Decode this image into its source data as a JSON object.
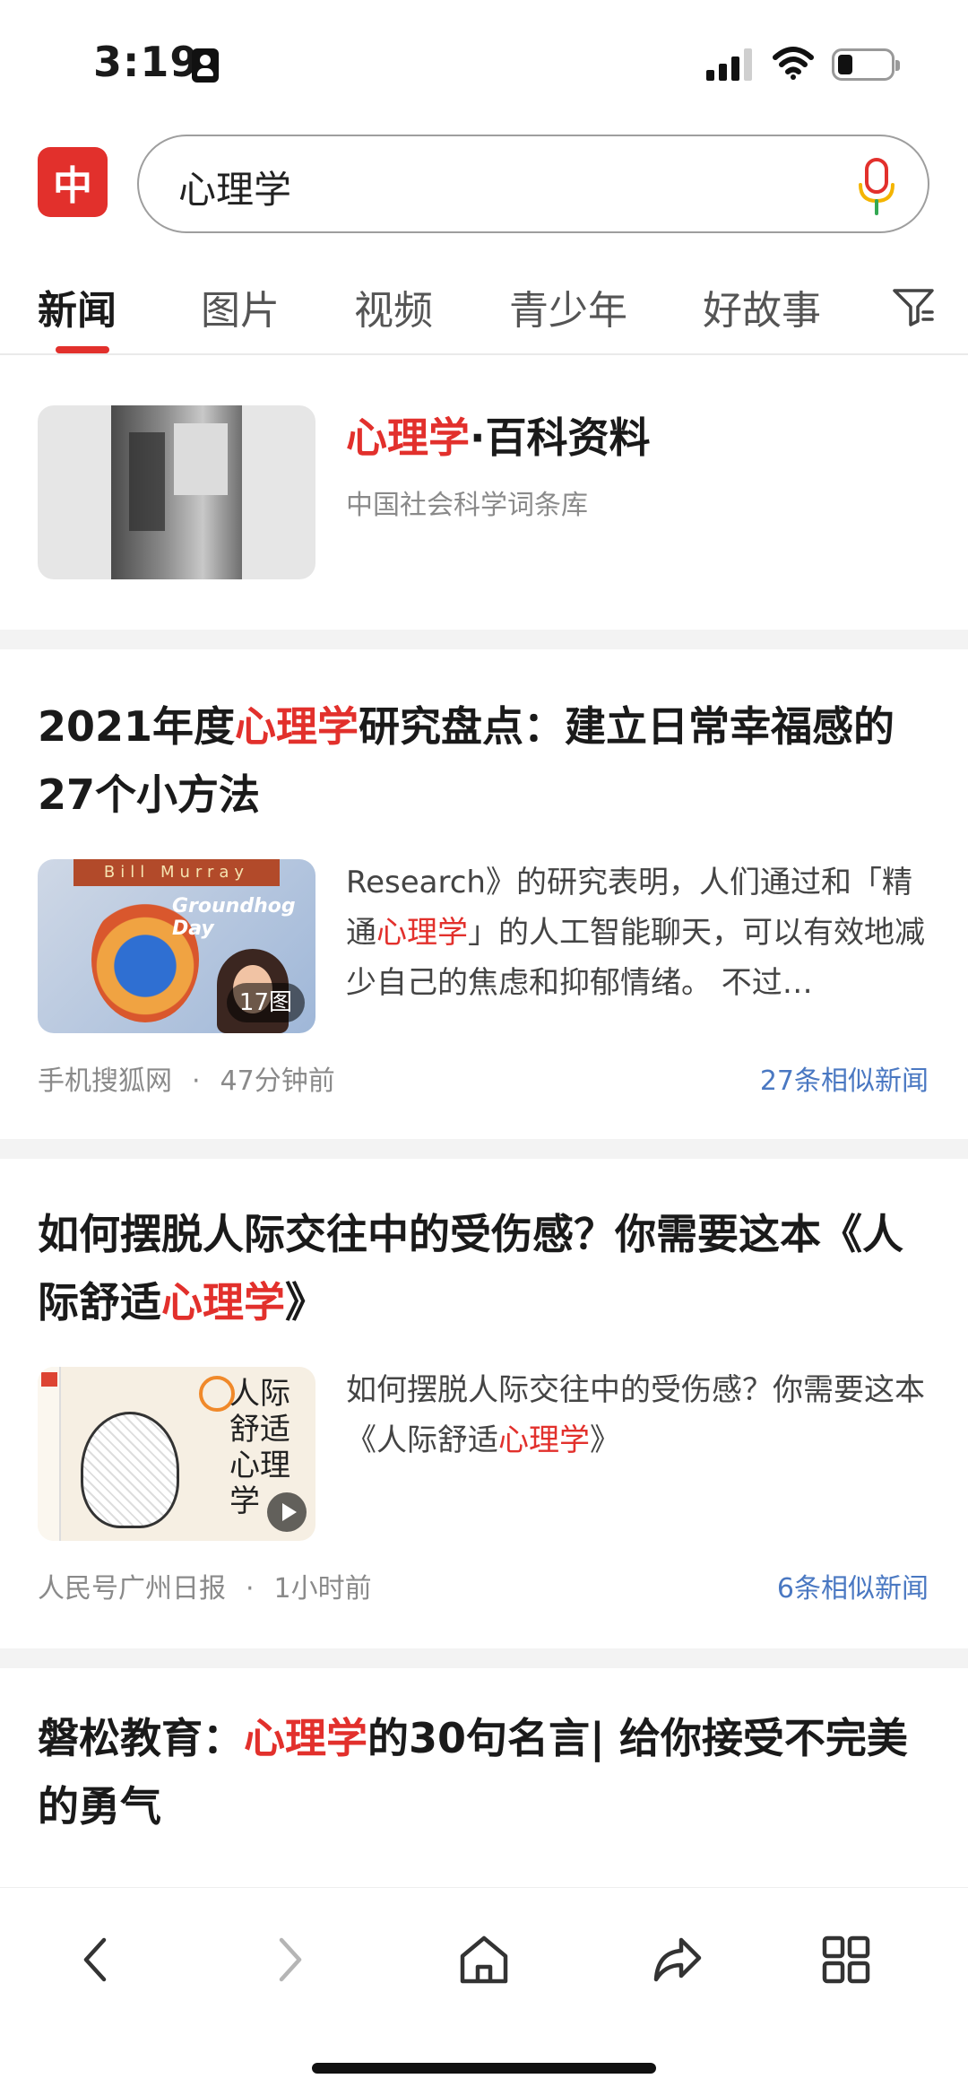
{
  "status_bar": {
    "time": "3:19"
  },
  "search": {
    "logo_char": "中",
    "query": "心理学",
    "mic_icon": "microphone-icon"
  },
  "tabs": [
    "新闻",
    "图片",
    "视频",
    "青少年",
    "好故事"
  ],
  "active_tab": "新闻",
  "colors": {
    "accent": "#e2302c",
    "link": "#4a78c2"
  },
  "encyclopedia": {
    "title_hl": "心理学",
    "title_rest": "·百科资料",
    "source": "中国社会科学词条库"
  },
  "news": [
    {
      "title_pre": "2021年度",
      "title_hl": "心理学",
      "title_post": "研究盘点：建立日常幸福感的27个小方法",
      "snippet_pre": "Research》的研究表明，人们通过和「精通",
      "snippet_hl": "心理学",
      "snippet_post": "」的人工智能聊天，可以有效地减少自己的焦虑和抑郁情绪。 不过…",
      "image_count": "17图",
      "thumb_banner": "Bill Murray",
      "thumb_title": "Groundhog Day",
      "source": "手机搜狐网",
      "time": "47分钟前",
      "similar": "27条相似新闻"
    },
    {
      "title_pre": "如何摆脱人际交往中的受伤感？你需要这本《人际舒适",
      "title_hl": "心理学",
      "title_post": "》",
      "snippet_pre": "如何摆脱人际交往中的受伤感？你需要这本《人际舒适",
      "snippet_hl": "心理学",
      "snippet_post": "》",
      "thumb_text": "人际舒适心理学",
      "source": "人民号广州日报",
      "time": "1小时前",
      "similar": "6条相似新闻"
    },
    {
      "title_pre": "磐松教育：",
      "title_hl": "心理学",
      "title_post": "的30句名言| 给你接受不完美的勇气"
    }
  ],
  "separator": "·",
  "toolbar": [
    "back-icon",
    "forward-icon",
    "home-icon",
    "share-icon",
    "tabs-grid-icon"
  ]
}
